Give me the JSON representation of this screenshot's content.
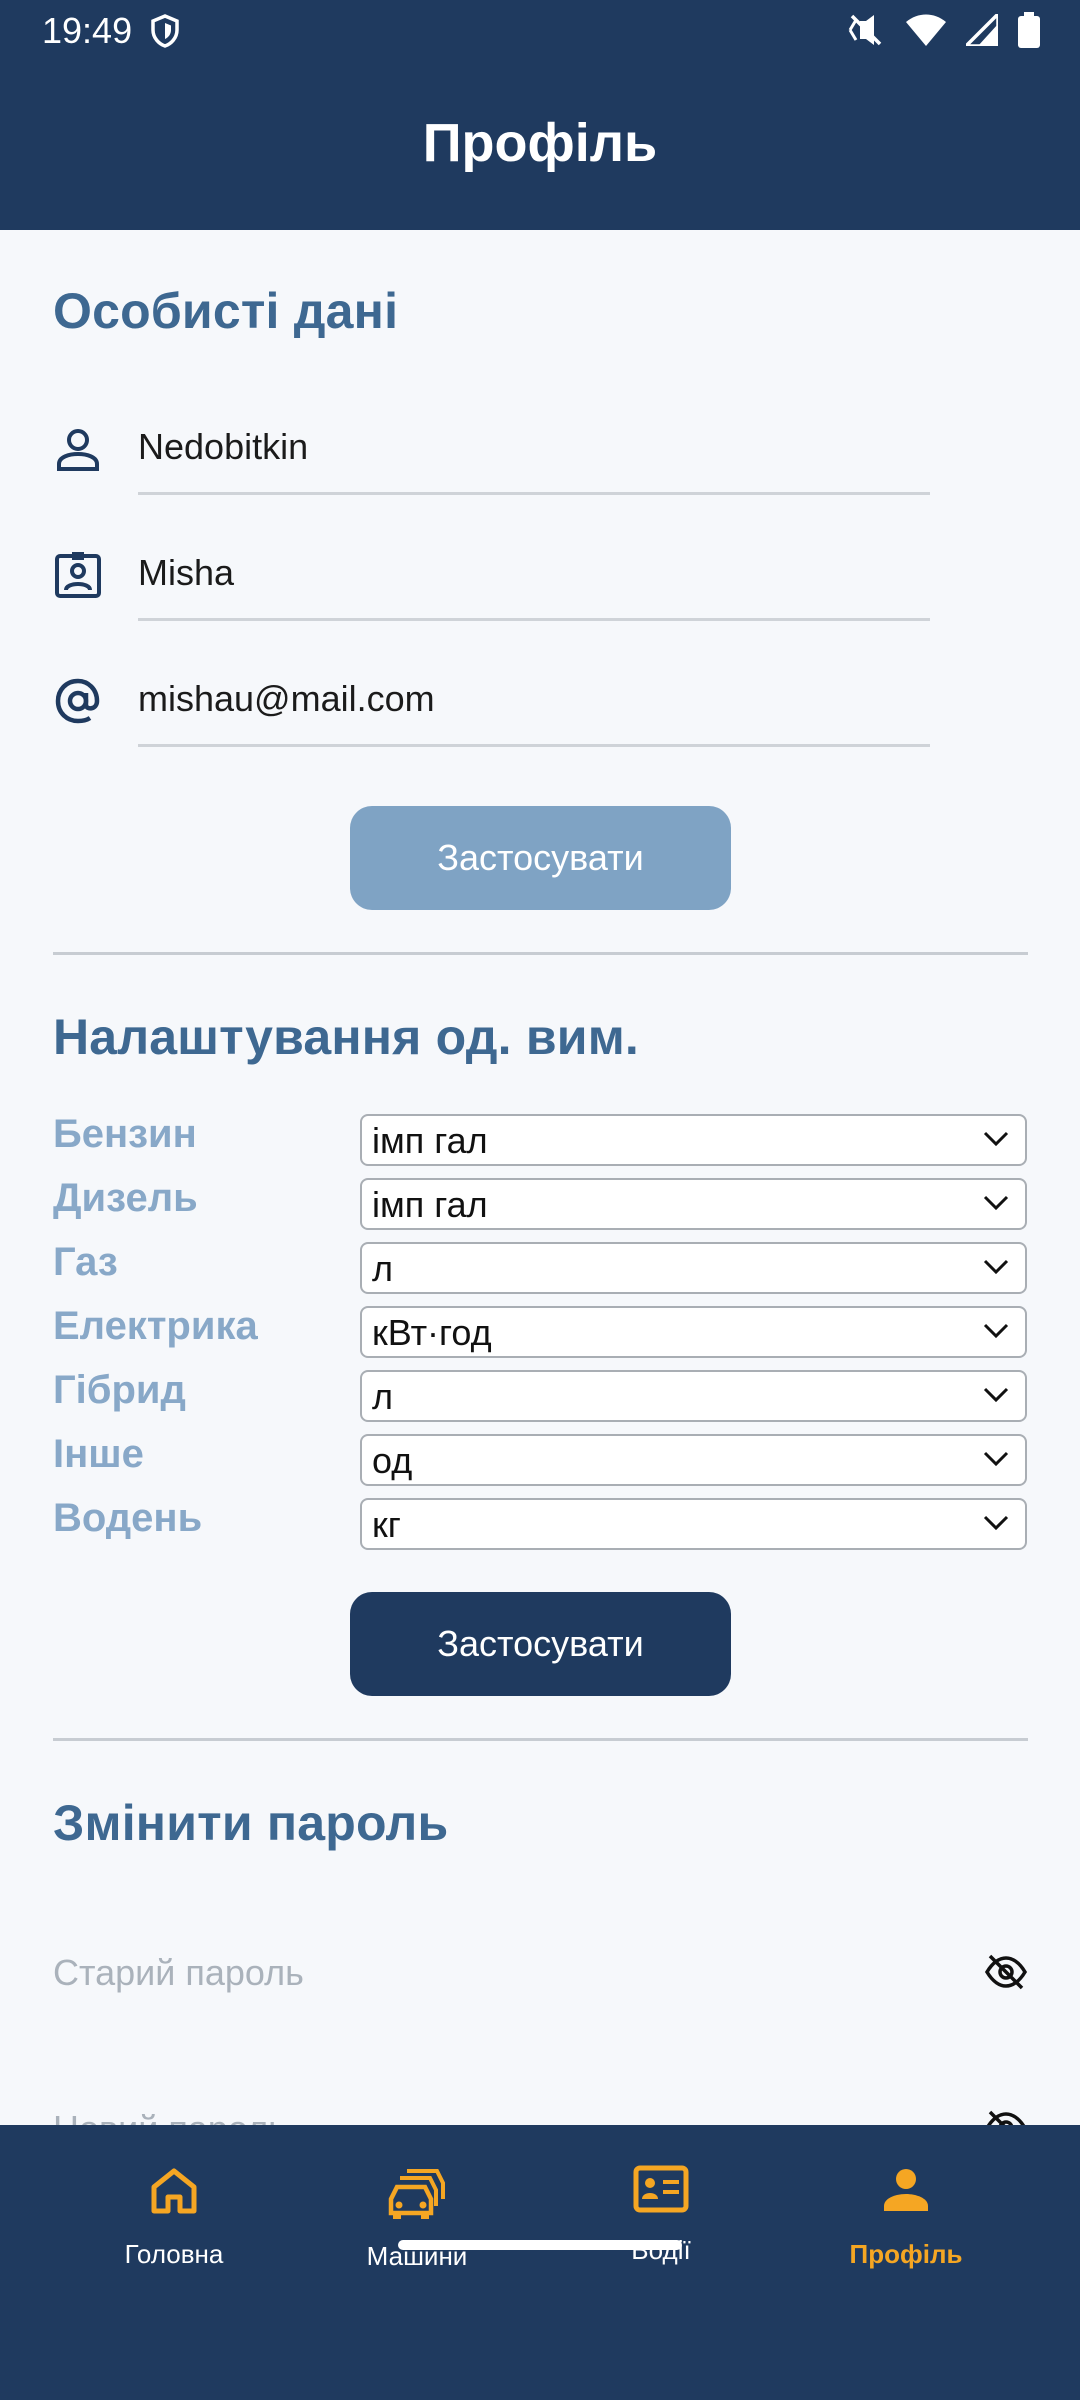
{
  "status": {
    "time": "19:49"
  },
  "header": {
    "title": "Профіль"
  },
  "personal": {
    "title": "Особисті дані",
    "last_name": "Nedobitkin",
    "first_name": "Misha",
    "email": "mishau@mail.com",
    "apply_label": "Застосувати"
  },
  "units": {
    "title": "Налаштування од. вим.",
    "rows": [
      {
        "label": "Бензин",
        "value": "імп гал"
      },
      {
        "label": "Дизель",
        "value": "імп гал"
      },
      {
        "label": "Газ",
        "value": "л"
      },
      {
        "label": "Електрика",
        "value": "кВт·год"
      },
      {
        "label": "Гібрид",
        "value": "л"
      },
      {
        "label": "Інше",
        "value": "од"
      },
      {
        "label": "Водень",
        "value": "кг"
      }
    ],
    "apply_label": "Застосувати"
  },
  "password": {
    "title": "Змінити пароль",
    "old_placeholder": "Старий пароль",
    "new_placeholder": "Новий пароль"
  },
  "nav": {
    "items": [
      {
        "label": "Головна",
        "icon": "home-icon"
      },
      {
        "label": "Машини",
        "icon": "cars-icon"
      },
      {
        "label": "Водії",
        "icon": "driver-card-icon"
      },
      {
        "label": "Профіль",
        "icon": "person-icon"
      }
    ],
    "active": "Профіль"
  },
  "colors": {
    "primary": "#1f3a5f",
    "accent": "#f5a623",
    "section_title": "#3e6891",
    "unit_label": "#88a8c8",
    "disabled_button": "#7fa3c4"
  }
}
